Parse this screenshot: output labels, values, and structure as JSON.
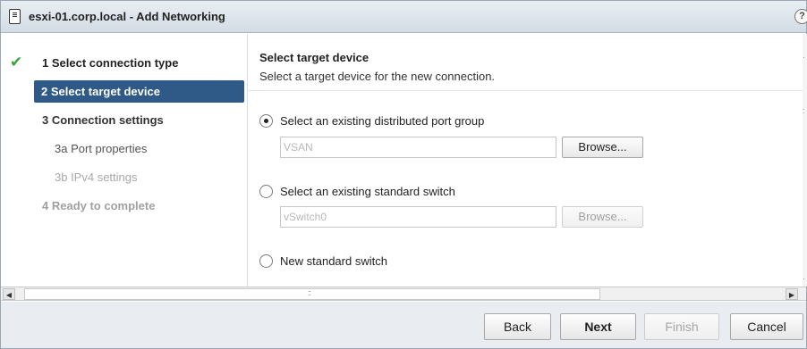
{
  "window": {
    "title": "esxi-01.corp.local - Add Networking",
    "help_glyph": "?"
  },
  "steps": [
    {
      "label": "1  Select connection type",
      "state": "completed",
      "color": "#222222",
      "weight": "bold"
    },
    {
      "label": "2  Select target device",
      "state": "current",
      "color": "#ffffff",
      "weight": "bold"
    },
    {
      "label": "3  Connection settings",
      "state": "pending",
      "color": "#333333",
      "weight": "bold"
    },
    {
      "label": "3a  Port properties",
      "state": "pending",
      "color": "#555555",
      "weight": "normal"
    },
    {
      "label": "3b  IPv4 settings",
      "state": "disabled",
      "color": "#a8a8a8",
      "weight": "normal"
    },
    {
      "label": "4  Ready to complete",
      "state": "disabled",
      "color": "#a0a0a0",
      "weight": "bold"
    }
  ],
  "main": {
    "title": "Select target device",
    "subtitle": "Select a target device for the new connection.",
    "options": [
      {
        "label": "Select an existing distributed port group",
        "checked": true
      },
      {
        "label": "Select an existing standard switch",
        "checked": false
      },
      {
        "label": "New standard switch",
        "checked": false
      }
    ],
    "fields": {
      "port_group_value": "VSAN",
      "standard_switch_value": "vSwitch0",
      "browse_label": "Browse..."
    }
  },
  "scrollbar": {
    "grip": "::",
    "left_arrow": "◀",
    "right_arrow": "▶"
  },
  "footer": {
    "back": "Back",
    "next": "Next",
    "finish": "Finish",
    "cancel": "Cancel"
  },
  "colors": {
    "accent": "#2f5a87",
    "check": "#3aa53a",
    "footer_bg": "#e9edf1"
  }
}
